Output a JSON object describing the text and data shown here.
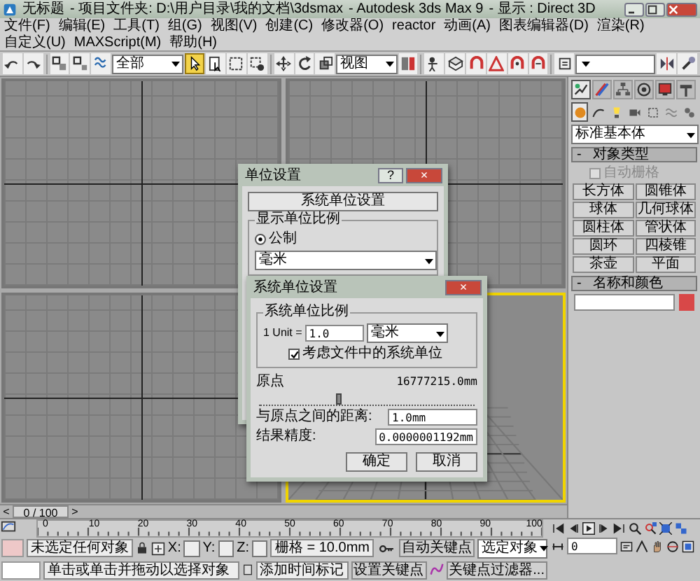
{
  "window": {
    "title": "无标题",
    "project": "- 项目文件夹: D:\\用户目录\\我的文档\\3dsmax",
    "app": "- Autodesk 3ds Max 9",
    "display": "- 显示 : Direct 3D"
  },
  "menu": [
    "文件(F)",
    "编辑(E)",
    "工具(T)",
    "组(G)",
    "视图(V)",
    "创建(C)",
    "修改器(O)",
    "reactor",
    "动画(A)",
    "图表编辑器(D)",
    "渲染(R)",
    "自定义(U)",
    "MAXScript(M)",
    "帮助(H)"
  ],
  "toolbar": {
    "selection_filter": "全部",
    "reference_coordinates": "视图",
    "select_tool": {
      "selected": true
    }
  },
  "viewports": [
    {
      "active": false
    },
    {
      "active": false
    },
    {
      "active": false
    },
    {
      "active": true
    }
  ],
  "unit_setup_dialog": {
    "title": "单位设置",
    "help_button": "?",
    "close_button": "×",
    "system_unit_button": "系统单位设置",
    "group": "显示单位比例",
    "options": [
      {
        "label": "公制",
        "selected": true
      }
    ],
    "unit": "毫米"
  },
  "system_unit_dialog": {
    "title": "系统单位设置",
    "close_button": "×",
    "group": "系统单位比例",
    "unit_label": "1 Unit =",
    "unit_value": "1.0",
    "unit": "毫米",
    "respect_units": {
      "label": "考虑文件中的系统单位",
      "checked": true
    },
    "origin_label": "原点",
    "origin_value": "16777215.0mm",
    "origin_slider": {
      "level": 0.36
    },
    "distance_label": "与原点之间的距离:",
    "distance_value": "1.0mm",
    "precision_label": "结果精度:",
    "precision_value": "0.0000001192mm",
    "buttons": [
      "确定",
      "取消"
    ]
  },
  "command_panel": {
    "tabs": [
      {
        "selected": true
      },
      {
        "selected": false
      },
      {
        "selected": false
      },
      {
        "selected": false
      },
      {
        "selected": false
      },
      {
        "selected": false
      }
    ],
    "categories": [
      {
        "selected": true
      },
      {
        "selected": false
      },
      {
        "selected": false
      },
      {
        "selected": false
      },
      {
        "selected": false
      },
      {
        "selected": false
      },
      {
        "selected": false
      }
    ],
    "category": "标准基本体",
    "object_type": {
      "collapse": "-",
      "title": "对象类型",
      "autogrid": {
        "label": "自动栅格",
        "checked": false,
        "disabled": true
      },
      "buttons": [
        "长方体",
        "圆锥体",
        "球体",
        "几何球体",
        "圆柱体",
        "管状体",
        "圆环",
        "四棱锥",
        "茶壶",
        "平面"
      ]
    },
    "name_color": {
      "collapse": "-",
      "title": "名称和颜色",
      "color": "#d84848"
    }
  },
  "time_slider": {
    "prev": "<",
    "label": "0 / 100",
    "next": ">",
    "level": 0
  },
  "ruler": {
    "ticks": [
      "0",
      "10",
      "20",
      "30",
      "40",
      "50",
      "60",
      "70",
      "80",
      "90",
      "100"
    ]
  },
  "status": {
    "selection": "未选定任何对象",
    "x_label": "X:",
    "y_label": "Y:",
    "z_label": "Z:",
    "grid": "栅格 = 10.0mm",
    "auto_key": "自动关键点",
    "key_mode": "选定对象",
    "prompt": "单击或单击并拖动以选择对象",
    "add_time_tag": "添加时间标记",
    "set_key": "设置关键点",
    "key_filters": "关键点过滤器...",
    "frame": "0"
  }
}
